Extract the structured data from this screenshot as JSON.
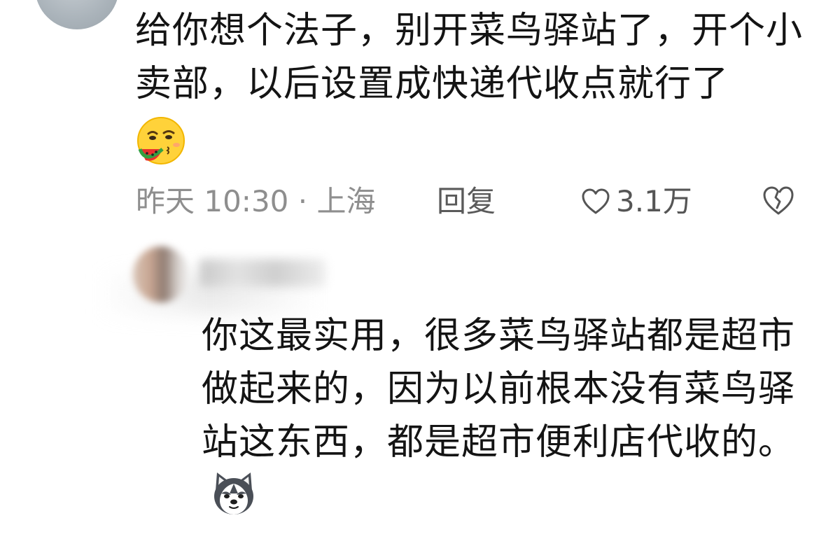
{
  "comment": {
    "text": "给你想个法子，别开菜鸟驿站了，开个小卖部，以后设置成快递代收点就行了",
    "emoji": "watermelon-eating-emoji",
    "time": "昨天 10:30 · 上海",
    "reply_label": "回复",
    "likes": "3.1万"
  },
  "reply": {
    "text": "你这最实用，很多菜鸟驿站都是超市做起来的，因为以前根本没有菜鸟驿站这东西，都是超市便利店代收的。",
    "emoji": "husky-dog-emoji"
  },
  "icons": {
    "like": "heart-outline-icon",
    "dislike": "broken-heart-icon"
  },
  "colors": {
    "meta_text": "#8e8e8e",
    "reply_action": "#5a5a5a",
    "body_text": "#141414"
  }
}
